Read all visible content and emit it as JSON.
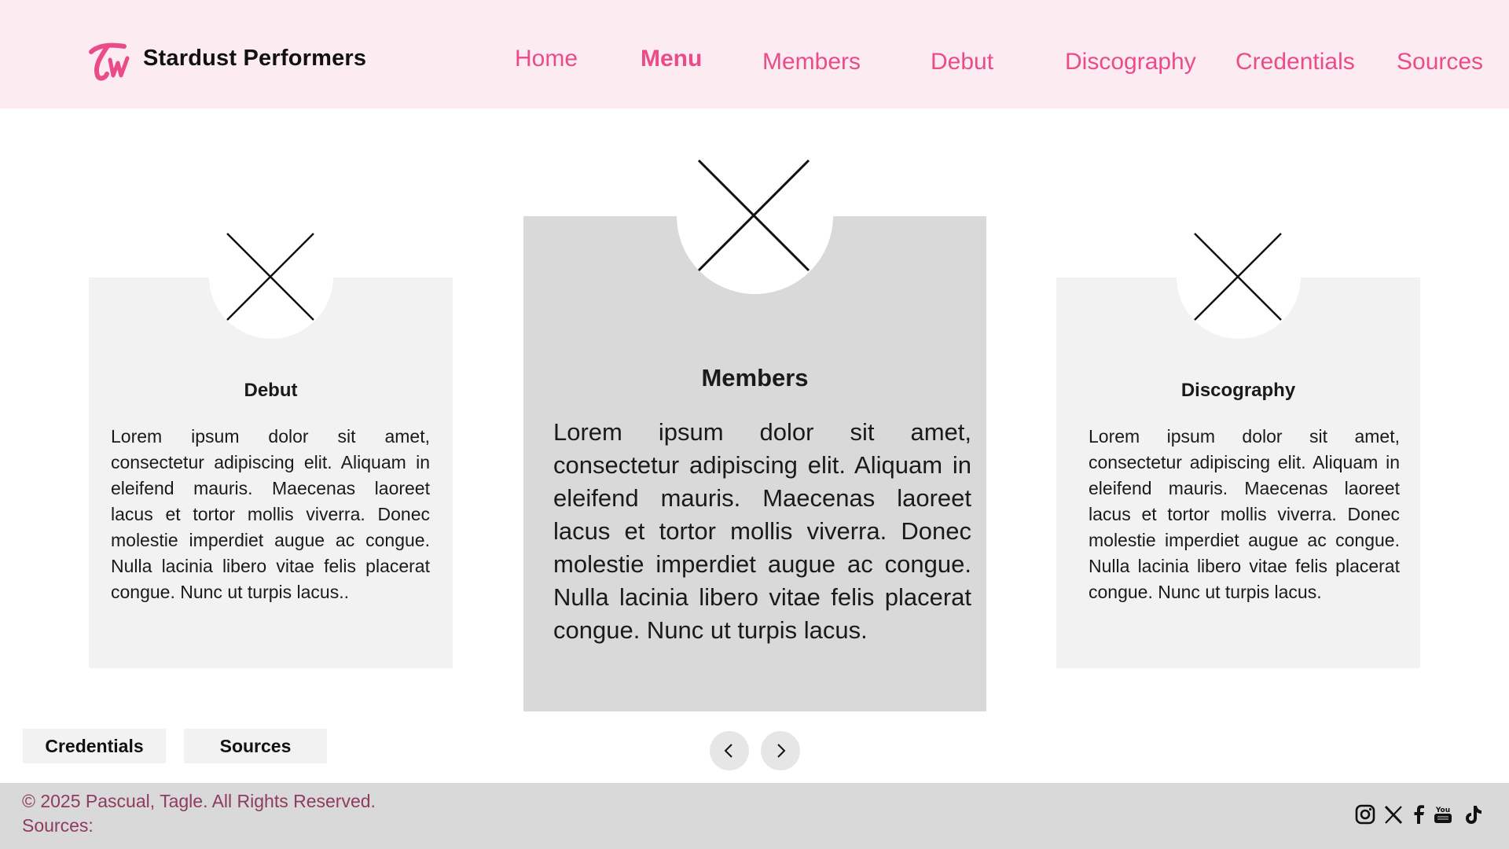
{
  "header": {
    "brand": "Stardust Performers",
    "logo_icon": "twice-logo-icon",
    "nav": [
      "Home",
      "Menu",
      "Members",
      "Debut",
      "Discography",
      "Credentials",
      "Sources"
    ]
  },
  "cards": [
    {
      "title": "Debut",
      "image_icon": "image-placeholder-icon",
      "body": "Lorem ipsum dolor sit amet, consectetur adipiscing elit. Aliquam in eleifend mauris. Maecenas laoreet lacus et tortor mollis viverra. Donec molestie imperdiet augue ac congue. Nulla lacinia libero vitae felis placerat congue. Nunc ut turpis lacus.."
    },
    {
      "title": "Members",
      "image_icon": "image-placeholder-icon",
      "body": "Lorem ipsum dolor sit amet, consectetur adipiscing elit. Aliquam in eleifend mauris. Maecenas laoreet lacus et tortor mollis viverra. Donec molestie imperdiet augue ac congue. Nulla lacinia libero vitae felis placerat congue. Nunc ut turpis lacus."
    },
    {
      "title": "Discography",
      "image_icon": "image-placeholder-icon",
      "body": "Lorem ipsum dolor sit amet, consectetur adipiscing elit. Aliquam in eleifend mauris. Maecenas laoreet lacus et tortor mollis viverra. Donec molestie imperdiet augue ac congue. Nulla lacinia libero vitae felis placerat congue. Nunc ut turpis lacus."
    }
  ],
  "pills": {
    "credentials": "Credentials",
    "sources": "Sources"
  },
  "carousel": {
    "prev_icon": "chevron-left-icon",
    "next_icon": "chevron-right-icon"
  },
  "footer": {
    "copyright": "© 2025 Pascual, Tagle. All Rights Reserved.",
    "sources": "Sources:",
    "social_icons": [
      "instagram-icon",
      "x-icon",
      "facebook-icon",
      "youtube-icon",
      "tiktok-icon"
    ]
  },
  "colors": {
    "header_bg": "#fdebf2",
    "accent": "#ea4c89",
    "card_side": "#f2f2f2",
    "card_center": "#d9d9d9",
    "footer_bg": "#d9d9d9",
    "footer_text": "#8e3b5f"
  }
}
